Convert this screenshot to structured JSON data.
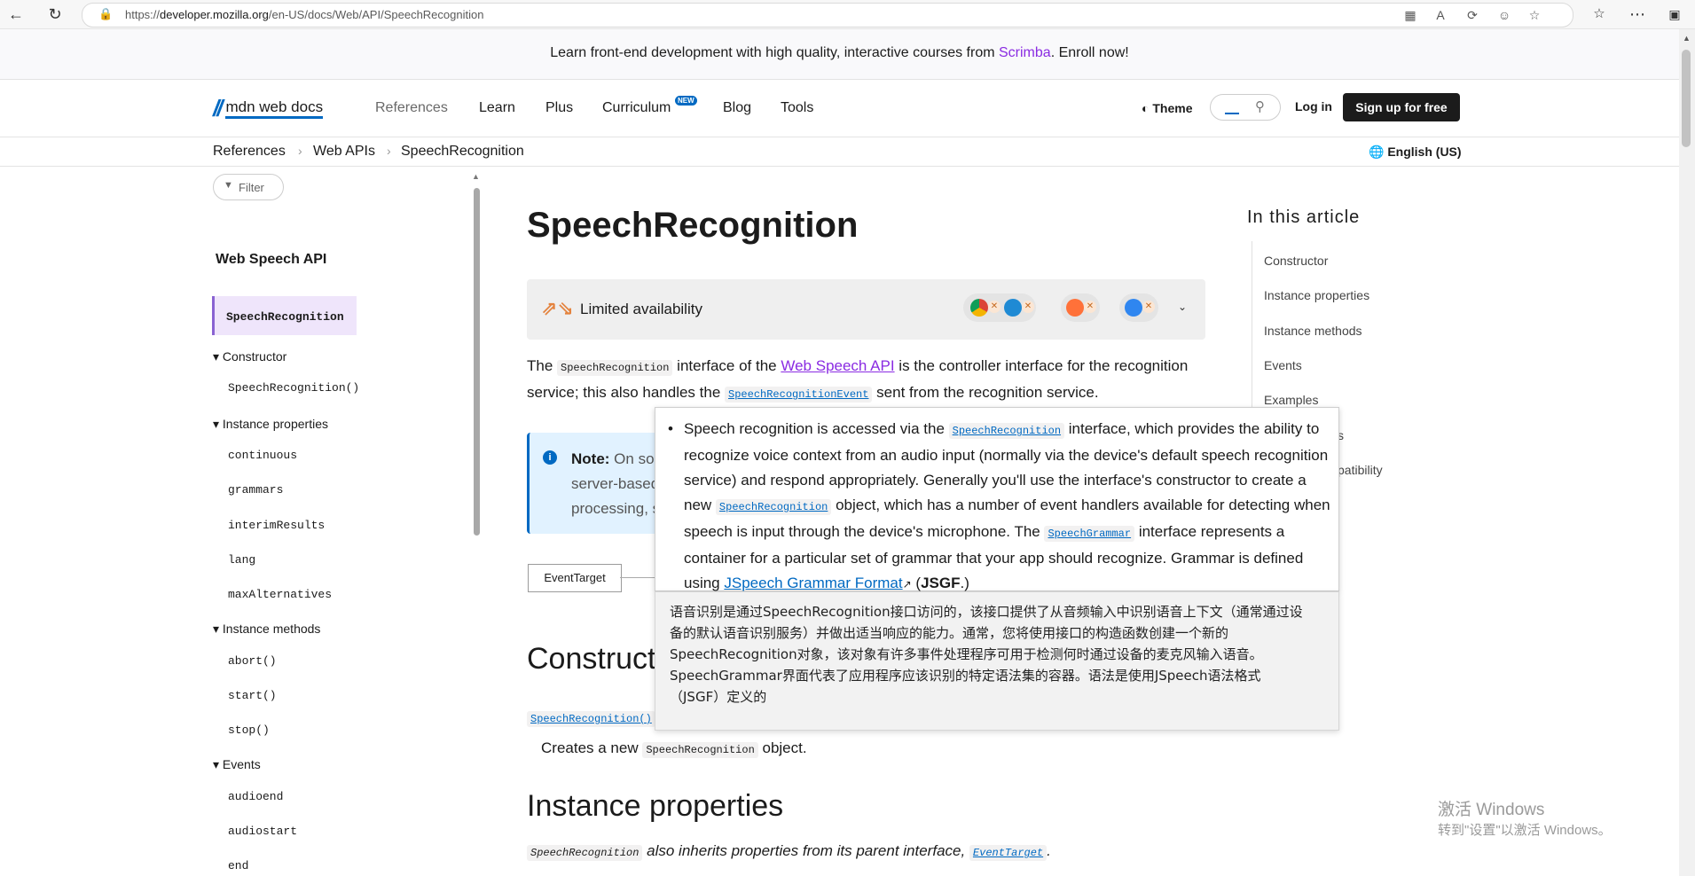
{
  "browser": {
    "url_prefix": "https://",
    "url_host": "developer.mozilla.org",
    "url_path": "/en-US/docs/Web/API/SpeechRecognition",
    "icons": [
      "back-icon",
      "reload-icon",
      "lock-icon",
      "split-screen-icon",
      "translate-icon",
      "refresh-icon",
      "emoji-icon",
      "favorite-icon",
      "favorites-list-icon",
      "more-icon",
      "sidebar-icon"
    ]
  },
  "banner": {
    "text_before": "Learn front-end development with high quality, interactive courses from ",
    "link": "Scrimba",
    "text_after": ". Enroll now!"
  },
  "header": {
    "logo": "mdn web docs",
    "nav": [
      "References",
      "Learn",
      "Plus",
      "Curriculum",
      "Blog",
      "Tools"
    ],
    "new_badge": "NEW",
    "theme": "Theme",
    "login": "Log in",
    "signup": "Sign up for free"
  },
  "breadcrumb": [
    "References",
    "Web APIs",
    "SpeechRecognition"
  ],
  "language": "English (US)",
  "sidebar": {
    "filter": "Filter",
    "title": "Web Speech API",
    "active": "SpeechRecognition",
    "groups": [
      {
        "label": "Constructor",
        "items": [
          "SpeechRecognition()"
        ]
      },
      {
        "label": "Instance properties",
        "items": [
          "continuous",
          "grammars",
          "interimResults",
          "lang",
          "maxAlternatives"
        ]
      },
      {
        "label": "Instance methods",
        "items": [
          "abort()",
          "start()",
          "stop()"
        ]
      },
      {
        "label": "Events",
        "items": [
          "audioend",
          "audiostart",
          "end"
        ]
      }
    ]
  },
  "main": {
    "title": "SpeechRecognition",
    "availability": "Limited availability",
    "intro": {
      "t1": "The ",
      "c1": "SpeechRecognition",
      "t2": " interface of the ",
      "link": "Web Speech API",
      "t3": " is the controller interface for the recognition service; this also handles the ",
      "c2": "SpeechRecognitionEvent",
      "t4": " sent from the recognition service."
    },
    "note": {
      "label": "Note:",
      "text": " On som server-based processing, s"
    },
    "inheritance_box": "EventTarget",
    "h_constructor": "Construct",
    "ctor_link": "SpeechRecognition()",
    "ctor_desc_1": "Creates a new ",
    "ctor_desc_code": "SpeechRecognition",
    "ctor_desc_2": " object.",
    "h_instance_props": "Instance properties",
    "ip_code": "SpeechRecognition",
    "ip_text": " also inherits properties from its parent interface, ",
    "ip_link": "EventTarget",
    "ip_end": "."
  },
  "toc": {
    "title": "In this article",
    "items": [
      "Constructor",
      "Instance properties",
      "Instance methods",
      "Events",
      "Examples",
      "s",
      "patibility"
    ]
  },
  "popup": {
    "p1": "Speech recognition is accessed via the ",
    "c1": "SpeechRecognition",
    "p2": " interface, which provides the ability to recognize voice context from an audio input (normally via the device's default speech recognition service) and respond appropriately. Generally you'll use the interface's constructor to create a new ",
    "c2": "SpeechRecognition",
    "p3": " object, which has a number of event handlers available for detecting when speech is input through the device's microphone. The ",
    "c3": "SpeechGrammar",
    "p4": " interface represents a container for a particular set of grammar that your app should recognize. Grammar is defined using ",
    "link": "JSpeech Grammar Format",
    "p5": " (",
    "bold": "JSGF",
    "p6": ".)"
  },
  "translation": "语音识别是通过SpeechRecognition接口访问的，该接口提供了从音频输入中识别语音上下文（通常通过设备的默认语音识别服务）并做出适当响应的能力。通常，您将使用接口的构造函数创建一个新的SpeechRecognition对象，该对象有许多事件处理程序可用于检测何时通过设备的麦克风输入语音。SpeechGrammar界面代表了应用程序应该识别的特定语法集的容器。语法是使用JSpeech语法格式（JSGF）定义的",
  "watermark": {
    "line1": "激活 Windows",
    "line2": "转到\"设置\"以激活 Windows。"
  }
}
